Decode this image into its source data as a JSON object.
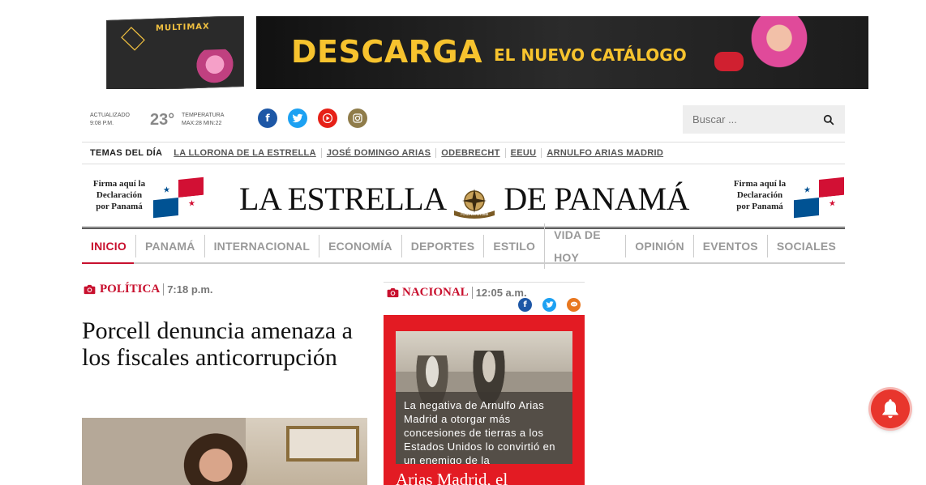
{
  "banner": {
    "catalog_brand": "MULTIMAX",
    "headline": "DESCARGA",
    "subline": "EL NUEVO CATÁLOGO"
  },
  "weather": {
    "updated_label": "ACTUALIZADO",
    "updated_time": "9:08 P.M.",
    "temperature": "23°",
    "temp_label": "TEMPERATURA",
    "temp_range": "MAX:28 MIN:22"
  },
  "social": {
    "facebook": "facebook-icon",
    "twitter": "twitter-icon",
    "youtube": "youtube-icon",
    "instagram": "instagram-icon"
  },
  "search": {
    "placeholder": "Buscar ..."
  },
  "temas": {
    "label": "TEMAS DEL DÍA",
    "items": [
      "LA LLORONA DE LA ESTRELLA",
      "JOSÉ DOMINGO ARIAS",
      "ODEBRECHT",
      "EEUU",
      "ARNULFO ARIAS MADRID"
    ]
  },
  "masthead": {
    "firma_line1": "Firma aquí la",
    "firma_line2": "Declaración",
    "firma_line3": "por Panamá",
    "logo_left": "LA ESTRELLA",
    "logo_right": "DE PANAMÁ",
    "emblem_text": "FUNDADO EN 1849"
  },
  "nav": {
    "items": [
      "INICIO",
      "PANAMÁ",
      "INTERNACIONAL",
      "ECONOMÍA",
      "DEPORTES",
      "ESTILO",
      "VIDA DE HOY",
      "OPINIÓN",
      "EVENTOS",
      "SOCIALES"
    ]
  },
  "article_left": {
    "category": "POLÍTICA",
    "time": "7:18 p.m.",
    "headline": "Porcell denuncia amenaza a los fiscales anticorrupción"
  },
  "article_right": {
    "category": "NACIONAL",
    "time": "12:05 a.m.",
    "caption": "La negativa de Arnulfo Arias Madrid a otorgar más concesiones de tierras a los Estados Unidos lo convirtió en un enemigo de la",
    "headline": "Arias Madrid, el"
  },
  "colors": {
    "accent": "#c8102e",
    "banner_yellow": "#f7c32e",
    "card_red": "#e31b23"
  }
}
